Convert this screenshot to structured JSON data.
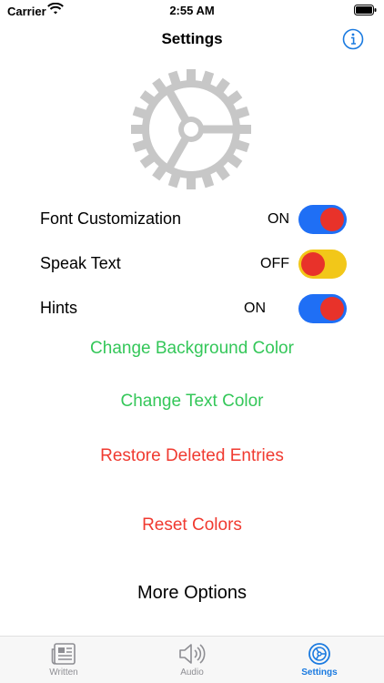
{
  "status": {
    "carrier": "Carrier",
    "time": "2:55 AM"
  },
  "nav": {
    "title": "Settings",
    "info_icon": "info-circle-icon"
  },
  "settings_icon": "gear-icon",
  "toggles": [
    {
      "label": "Font Customization",
      "state": "ON",
      "on": true
    },
    {
      "label": "Speak Text",
      "state": "OFF",
      "on": false
    },
    {
      "label": "Hints",
      "state": "ON",
      "on": true
    }
  ],
  "actions": {
    "change_background": "Change Background Color",
    "change_text": "Change Text Color",
    "restore_deleted": "Restore Deleted Entries",
    "reset_colors": "Reset Colors",
    "more_options": "More Options"
  },
  "tabs": [
    {
      "label": "Written",
      "icon": "newspaper-icon",
      "active": false
    },
    {
      "label": "Audio",
      "icon": "speaker-icon",
      "active": false
    },
    {
      "label": "Settings",
      "icon": "settings-icon",
      "active": true
    }
  ],
  "colors": {
    "toggle_on": "#1f6ff5",
    "toggle_off": "#f2c719",
    "knob": "#e8322a",
    "green_action": "#34c759",
    "red_action": "#f03a30",
    "tab_active": "#1a7ae0"
  }
}
